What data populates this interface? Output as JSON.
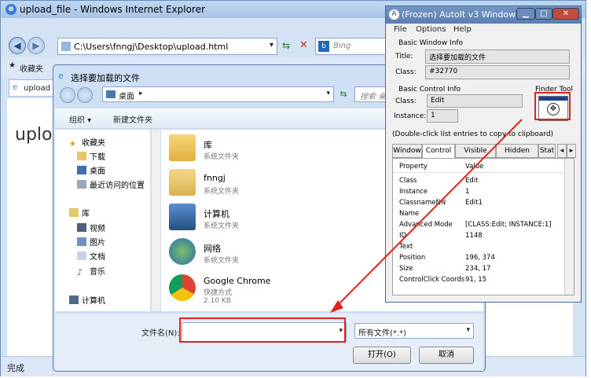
{
  "ie": {
    "title": "upload_file - Windows Internet Explorer",
    "address": "C:\\Users\\fnngj\\Desktop\\upload.html",
    "search_engine": "Bing",
    "tab_fav": "收藏夹",
    "tab_page": "upload",
    "heading": "uplo",
    "status": "完成",
    "accent": "#3a7ed4"
  },
  "dialog": {
    "title": "选择要加载的文件",
    "path_root": "桌面",
    "search_placeholder": "搜索 桌面",
    "organize": "组织 ▾",
    "new_folder": "新建文件夹",
    "nav": {
      "favorites": "收藏夹",
      "downloads": "下载",
      "desktop": "桌面",
      "recent": "最近访问的位置",
      "library": "库",
      "videos": "视频",
      "pictures": "图片",
      "documents": "文档",
      "music": "音乐",
      "computer": "计算机"
    },
    "files": [
      {
        "name": "库",
        "type": "系统文件夹"
      },
      {
        "name": "fnngj",
        "type": "系统文件夹"
      },
      {
        "name": "计算机",
        "type": "系统文件夹"
      },
      {
        "name": "网络",
        "type": "系统文件夹"
      },
      {
        "name": "Google Chrome",
        "type": "快捷方式",
        "size": "2.10 KB"
      }
    ],
    "filename_label": "文件名(N):",
    "filename_value": "",
    "filter": "所有文件(*.*)",
    "open_btn": "打开(O)",
    "cancel_btn": "取消"
  },
  "autoit": {
    "title": "(Frozen) AutoIt v3 Window I...",
    "menu": [
      "File",
      "Options",
      "Help"
    ],
    "basic_window_info": "Basic Window Info",
    "title_label": "Title:",
    "title_value": "选择要加载的文件",
    "class_label": "Class:",
    "class_value": "#32770",
    "basic_control_info": "Basic Control Info",
    "finder_tool": "Finder Tool",
    "ctrl_class_label": "Class:",
    "ctrl_class_value": "Edit",
    "instance_label": "Instance:",
    "instance_value": "1",
    "hint": "(Double-click list entries to copy to clipboard)",
    "tabs": [
      "Window",
      "Control",
      "Visible Text",
      "Hidden Text",
      "Stat"
    ],
    "columns": [
      "Property",
      "Value"
    ],
    "rows": [
      {
        "k": "Class",
        "v": "Edit"
      },
      {
        "k": "Instance",
        "v": "1"
      },
      {
        "k": "ClassnameNN",
        "v": "Edit1"
      },
      {
        "k": "Name",
        "v": ""
      },
      {
        "k": "Advanced Mode",
        "v": "[CLASS:Edit; INSTANCE:1]"
      },
      {
        "k": "ID",
        "v": "1148"
      },
      {
        "k": "Text",
        "v": ""
      },
      {
        "k": "Position",
        "v": "196, 374"
      },
      {
        "k": "Size",
        "v": "234, 17"
      },
      {
        "k": "ControlClick Coords",
        "v": "91, 15"
      }
    ]
  },
  "colors": {
    "annotation": "#e0221e"
  }
}
